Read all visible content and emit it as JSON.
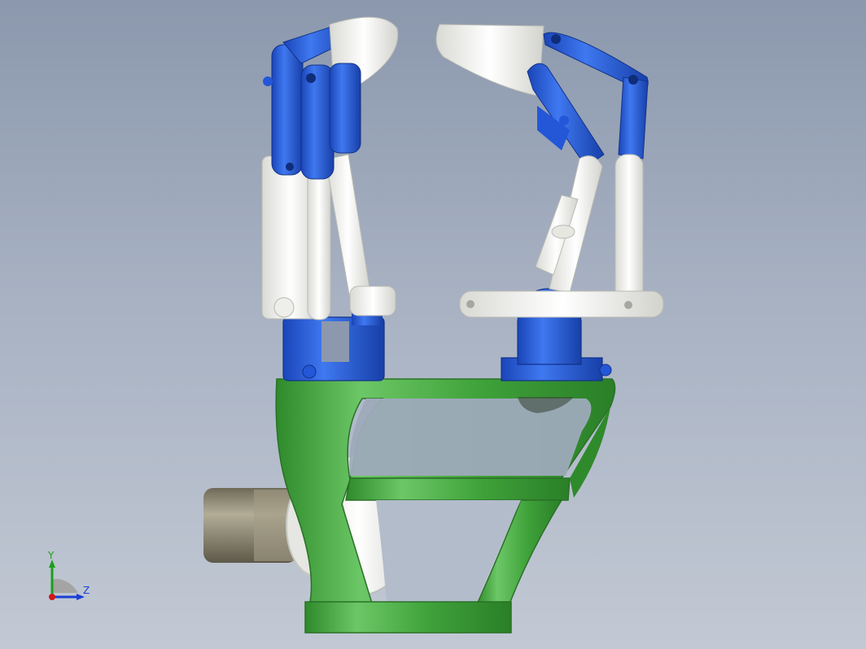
{
  "viewport": {
    "background_top": "#8b98ad",
    "background_bottom": "#c2c9d4"
  },
  "model": {
    "description_parts": [
      "gripper-base",
      "left-finger",
      "right-finger",
      "motor",
      "pulley"
    ],
    "colors": {
      "base_green": "#3fa23a",
      "link_blue": "#1f52d6",
      "link_white": "#f2f2ee",
      "motor_gray": "#8f8a76"
    }
  },
  "triad": {
    "y_label": "Y",
    "z_label": "Z",
    "colors": {
      "x": "#d01818",
      "y": "#1aa01a",
      "z": "#1a3fd6"
    }
  }
}
